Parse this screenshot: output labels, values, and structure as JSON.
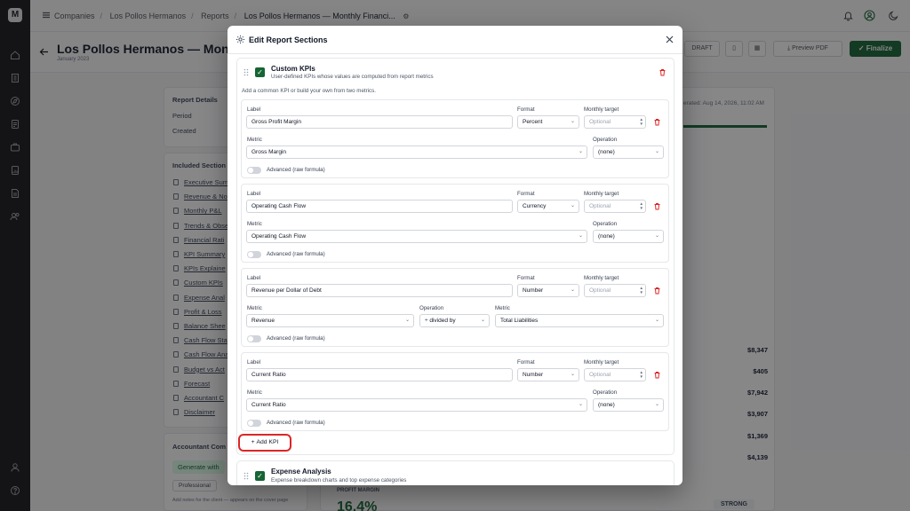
{
  "rail": {
    "logo": "M"
  },
  "breadcrumb": {
    "items": [
      "Companies",
      "Los Pollos Hermanos",
      "Reports",
      "Los Pollos Hermanos — Monthly Financi..."
    ]
  },
  "page": {
    "title": "Los Pollos Hermanos — Month",
    "subtitle": "January 2023",
    "draft_label": "DRAFT",
    "preview_label": "Preview PDF",
    "finalize_label": "Finalize"
  },
  "background": {
    "report_details": "Report Details",
    "period": "Period",
    "created": "Created",
    "included_sections": "Included Section",
    "sections": [
      "Executive Sum",
      "Revenue & No",
      "Monthly P&L",
      "Trends & Obse",
      "Financial Rati",
      "KPI Summary",
      "KPIs Explaine",
      "Custom KPIs",
      "Expense Anal",
      "Profit & Loss",
      "Balance Shee",
      "Cash Flow Sta",
      "Cash Flow Ana",
      "Budget vs Act",
      "Forecast",
      "Accountant C",
      "Disclaimer"
    ],
    "accountant_comments": "Accountant Com",
    "generate_label": "Generate with",
    "professional_label": "Professional",
    "notes_hint": "Add notes for the client — appears on the cover page",
    "generated": "erated: Aug 14, 2026, 11:02 AM",
    "amounts": [
      "$8,347",
      "$405",
      "$7,942",
      "$3,907",
      "$1,369",
      "$4,139"
    ],
    "profit_margin_label": "PROFIT MARGIN",
    "profit_margin_value": "16.4%",
    "strong_label": "STRONG"
  },
  "modal": {
    "title": "Edit Report Sections",
    "custom_kpis": {
      "title": "Custom KPIs",
      "description": "User-defined KPIs whose values are computed from report metrics",
      "hint": "Add a common KPI or build your own from two metrics.",
      "labels": {
        "label": "Label",
        "format": "Format",
        "monthly_target": "Monthly target",
        "metric": "Metric",
        "operation": "Operation",
        "advanced": "Advanced (raw formula)",
        "target_placeholder": "Optional"
      },
      "kpis": [
        {
          "label": "Gross Profit Margin",
          "format": "Percent",
          "metric": "Gross Margin",
          "operation": "(none)"
        },
        {
          "label": "Operating Cash Flow",
          "format": "Currency",
          "metric": "Operating Cash Flow",
          "operation": "(none)"
        },
        {
          "label": "Revenue per Dollar of Debt",
          "format": "Number",
          "metric": "Revenue",
          "operation": "÷ divided by",
          "metric2": "Total Liabilities"
        },
        {
          "label": "Current Ratio",
          "format": "Number",
          "metric": "Current Ratio",
          "operation": "(none)"
        }
      ],
      "add_kpi_label": "Add KPI"
    },
    "expense_analysis": {
      "title": "Expense Analysis",
      "description": "Expense breakdown charts and top expense categories"
    }
  },
  "colors": {
    "brand": "#166534",
    "danger": "#dc2626"
  }
}
